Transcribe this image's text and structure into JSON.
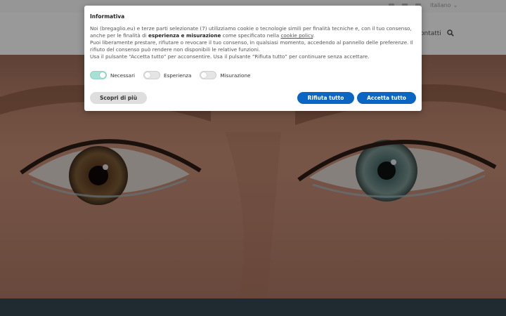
{
  "topbar": {
    "language": "italiano",
    "social_icons": [
      "social-icon-1",
      "social-icon-2",
      "social-icon-3"
    ]
  },
  "nav": {
    "contatti_label": "ontatti",
    "search_icon": "search-icon"
  },
  "cookie": {
    "title": "Informativa",
    "line1a": "Noi (bregaglio.eu) e terze parti selezionate (7) utilizziamo cookie o tecnologie simili per finalità tecniche e, con il tuo consenso, anche per le finalità di",
    "line1_bold": "esperienza e misurazione",
    "line1b": "come specificato nella",
    "policy_link": "cookie policy",
    "line1c": ".",
    "line2": "Puoi liberamente prestare, rifiutare o revocare il tuo consenso, in qualsiasi momento, accedendo al pannello delle preferenze. Il rifiuto del consenso può rendere non disponibili le relative funzioni.",
    "line3": "Usa il pulsante “Accetta tutto” per acconsentire. Usa il pulsante “Rifiuta tutto” per continuare senza accettare.",
    "toggles": [
      {
        "label": "Necessari",
        "on": true
      },
      {
        "label": "Esperienza",
        "on": false
      },
      {
        "label": "Misurazione",
        "on": false
      }
    ],
    "more_label": "Scopri di più",
    "reject_label": "Rifiuta tutto",
    "accept_label": "Accetta tutto",
    "accent_color": "#0a66c2"
  }
}
